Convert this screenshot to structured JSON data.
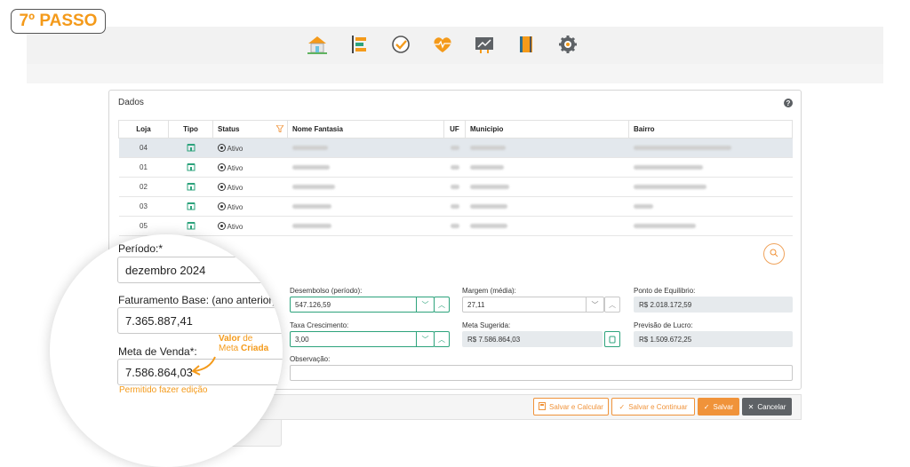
{
  "badge": "7º PASSO",
  "nav_icons": [
    "home-icon",
    "list-icon",
    "check-circle-icon",
    "heart-pulse-icon",
    "chart-board-icon",
    "notebook-icon",
    "gear-icon"
  ],
  "panel": {
    "title": "Dados",
    "help": "?"
  },
  "table": {
    "headers": [
      "Loja",
      "Tipo",
      "Status",
      "Nome Fantasia",
      "UF",
      "Municipio",
      "Bairro"
    ],
    "rows": [
      {
        "loja": "04",
        "status": "Ativo"
      },
      {
        "loja": "01",
        "status": "Ativo"
      },
      {
        "loja": "02",
        "status": "Ativo"
      },
      {
        "loja": "03",
        "status": "Ativo"
      },
      {
        "loja": "05",
        "status": "Ativo"
      }
    ]
  },
  "form": {
    "periodo_label": "Período:*",
    "periodo_value": "dezembro 2024",
    "fat_label": "Faturamento Base: (ano anterior)",
    "fat_value": "7.365.887,41",
    "meta_label": "Meta de Venda*:",
    "meta_value": "7.586.864,03",
    "desembolso_label": "Desembolso (período):",
    "desembolso_value": "547.126,59",
    "margem_label": "Margem (média):",
    "margem_value": "27,11",
    "pe_label": "Ponto de Equilibrio:",
    "pe_value": "R$ 2.018.172,59",
    "taxa_label": "Taxa Crescimento:",
    "taxa_value": "3,00",
    "metasug_label": "Meta Sugerida:",
    "metasug_value": "R$ 7.586.864,03",
    "previsao_label": "Previsão de Lucro:",
    "previsao_value": "R$ 1.509.672,25",
    "obs_label": "Observação:",
    "obs_value": ""
  },
  "annotation": {
    "l1a": "Valor",
    "l1b": "de",
    "l2a": "Meta",
    "l2b": "Criada",
    "hint": "Permitido fazer edição"
  },
  "buttons": {
    "calc": "Salvar e Calcular",
    "continuar": "Salvar e Continuar",
    "salvar": "Salvar",
    "cancelar": "Cancelar"
  },
  "colors": {
    "accent": "#f0933a",
    "green": "#2da37c",
    "dark": "#5e6266"
  }
}
